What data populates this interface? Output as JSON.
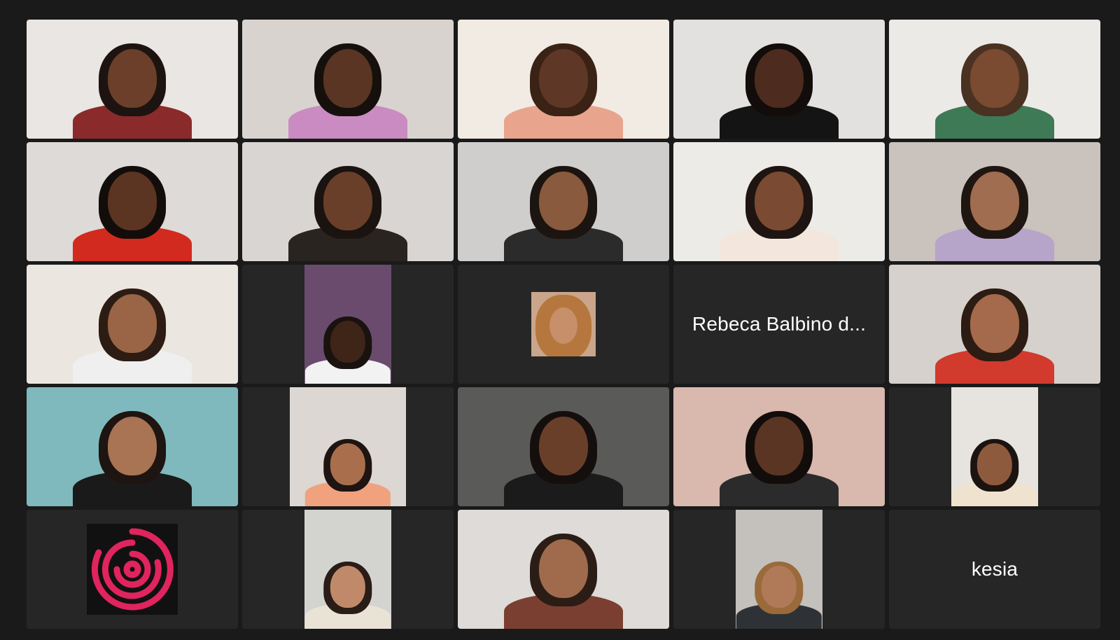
{
  "meeting": {
    "participants": [
      {
        "type": "video",
        "bg": "#e9e6e3",
        "skin": "#6b3f2a",
        "hair": "#1d1411",
        "shirt": "#8b2a2a"
      },
      {
        "type": "video",
        "bg": "#d9d3cf",
        "skin": "#5a3524",
        "hair": "#16100d",
        "shirt": "#c98bc2",
        "active": true
      },
      {
        "type": "video",
        "bg": "#f1ebe4",
        "skin": "#5e3726",
        "hair": "#3a2215",
        "shirt": "#e8a48c"
      },
      {
        "type": "video",
        "bg": "#e3e1df",
        "skin": "#4d2c1f",
        "hair": "#120d0b",
        "shirt": "#141414"
      },
      {
        "type": "video",
        "bg": "#eceae7",
        "skin": "#7a4a31",
        "hair": "#4a3222",
        "shirt": "#3e7a55"
      },
      {
        "type": "video",
        "bg": "#dedad7",
        "skin": "#5c3422",
        "hair": "#120d0b",
        "shirt": "#d22a1f"
      },
      {
        "type": "video",
        "bg": "#d8d5d2",
        "skin": "#6a3f2a",
        "hair": "#1a1310",
        "shirt": "#2a2421"
      },
      {
        "type": "video",
        "bg": "#cfcecd",
        "skin": "#8a5a3e",
        "hair": "#1c1410",
        "shirt": "#2b2b2b"
      },
      {
        "type": "video",
        "bg": "#ecebe8",
        "skin": "#7b4a32",
        "hair": "#1e1512",
        "shirt": "#f3e7dd"
      },
      {
        "type": "video",
        "bg": "#c9c2bd",
        "skin": "#a06d50",
        "hair": "#201611",
        "shirt": "#b7a4c9"
      },
      {
        "type": "video",
        "bg": "#ebe6e0",
        "skin": "#9a6447",
        "hair": "#2c1c13",
        "shirt": "#efefef"
      },
      {
        "type": "narrow",
        "bg": "#6a4b6e",
        "skin": "#3f2418",
        "hair": "#1a120e",
        "shirt": "#f2f2f2",
        "width": 124
      },
      {
        "type": "thumb",
        "bg": "#c9a58b",
        "skin": "#c78f6a",
        "hair": "#b5773e"
      },
      {
        "type": "name",
        "name": "Rebeca Balbino d..."
      },
      {
        "type": "video",
        "bg": "#d6d1cc",
        "skin": "#a56a4b",
        "hair": "#2c1c13",
        "shirt": "#d13a2d"
      },
      {
        "type": "video",
        "bg": "#7fb9bd",
        "skin": "#a87454",
        "hair": "#1e1411",
        "shirt": "#1a1a1a"
      },
      {
        "type": "narrow",
        "bg": "#dcd7d2",
        "skin": "#a96f4c",
        "hair": "#1e1411",
        "shirt": "#f0a27e",
        "width": 166
      },
      {
        "type": "video",
        "bg": "#5a5a58",
        "skin": "#6a3f2a",
        "hair": "#140f0d",
        "shirt": "#1b1b1b"
      },
      {
        "type": "video",
        "bg": "#d9b8ad",
        "skin": "#5b3524",
        "hair": "#120d0b",
        "shirt": "#2b2b2b"
      },
      {
        "type": "narrow",
        "bg": "#e7e3de",
        "skin": "#8e5a3e",
        "hair": "#1b1310",
        "shirt": "#efe3cf",
        "width": 124
      },
      {
        "type": "logo",
        "color": "#e0245e"
      },
      {
        "type": "narrow",
        "bg": "#d3d4cf",
        "skin": "#c08a6a",
        "hair": "#2a1c16",
        "shirt": "#e9e3d6",
        "width": 124
      },
      {
        "type": "video",
        "bg": "#dedbd8",
        "skin": "#a06b4d",
        "hair": "#2b1d16",
        "shirt": "#7b3f32"
      },
      {
        "type": "narrow",
        "bg": "#c4c0bc",
        "skin": "#b07a58",
        "hair": "#9a6a3a",
        "shirt": "#2e3236",
        "width": 124
      },
      {
        "type": "name",
        "name": "kesia"
      }
    ]
  }
}
